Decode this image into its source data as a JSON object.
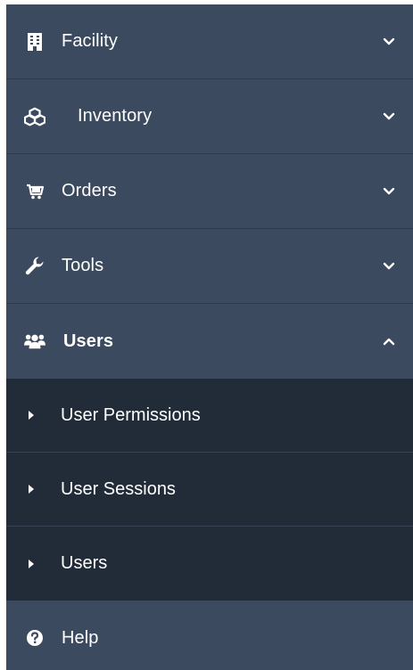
{
  "sidebar": {
    "items": [
      {
        "label": "Facility",
        "icon": "building-icon",
        "expanded": false
      },
      {
        "label": "Inventory",
        "icon": "cubes-icon",
        "expanded": false
      },
      {
        "label": "Orders",
        "icon": "cart-icon",
        "expanded": false
      },
      {
        "label": "Tools",
        "icon": "wrench-icon",
        "expanded": false
      },
      {
        "label": "Users",
        "icon": "users-icon",
        "expanded": true
      }
    ],
    "users_submenu": [
      {
        "label": "User Permissions"
      },
      {
        "label": "User Sessions"
      },
      {
        "label": "Users"
      }
    ],
    "help": {
      "label": "Help",
      "icon": "question-circle-icon"
    }
  },
  "colors": {
    "sidebar_bg": "#3b4a5e",
    "submenu_bg": "#222c38",
    "text": "#ffffff"
  }
}
